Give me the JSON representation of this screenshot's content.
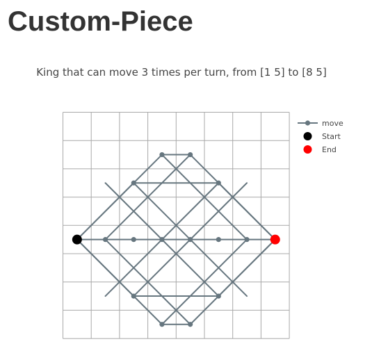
{
  "page": {
    "title": "Custom-Piece",
    "subtitle": "King that can move 3 times per turn, from [1 5] to [8 5]"
  },
  "colors": {
    "grid": "#a8a8a8",
    "move": "#66767f",
    "start": "#000000",
    "end": "#ff0000"
  },
  "legend": [
    {
      "label": "move",
      "marker": "line-dot",
      "color": "#66767f"
    },
    {
      "label": "Start",
      "marker": "dot",
      "color": "#000000"
    },
    {
      "label": "End",
      "marker": "dot",
      "color": "#ff0000"
    }
  ],
  "chart_data": {
    "type": "scatter",
    "board_files": 8,
    "board_ranks": 8,
    "start": [
      1,
      5
    ],
    "end": [
      8,
      5
    ],
    "moves": [
      [
        [
          1,
          5
        ],
        [
          4,
          8
        ]
      ],
      [
        [
          4,
          8
        ],
        [
          5,
          8
        ]
      ],
      [
        [
          5,
          8
        ],
        [
          8,
          5
        ]
      ],
      [
        [
          1,
          5
        ],
        [
          4,
          2
        ]
      ],
      [
        [
          4,
          2
        ],
        [
          5,
          2
        ]
      ],
      [
        [
          5,
          2
        ],
        [
          8,
          5
        ]
      ],
      [
        [
          1,
          5
        ],
        [
          3,
          7
        ]
      ],
      [
        [
          3,
          7
        ],
        [
          6,
          7
        ]
      ],
      [
        [
          6,
          7
        ],
        [
          8,
          5
        ]
      ],
      [
        [
          1,
          5
        ],
        [
          3,
          3
        ]
      ],
      [
        [
          3,
          3
        ],
        [
          6,
          3
        ]
      ],
      [
        [
          6,
          3
        ],
        [
          8,
          5
        ]
      ],
      [
        [
          1,
          5
        ],
        [
          8,
          5
        ]
      ],
      [
        [
          2,
          5
        ],
        [
          5,
          8
        ]
      ],
      [
        [
          4,
          8
        ],
        [
          7,
          5
        ]
      ],
      [
        [
          2,
          5
        ],
        [
          5,
          2
        ]
      ],
      [
        [
          4,
          2
        ],
        [
          7,
          5
        ]
      ],
      [
        [
          3,
          7
        ],
        [
          7,
          3
        ]
      ],
      [
        [
          6,
          7
        ],
        [
          2,
          3
        ]
      ],
      [
        [
          3,
          3
        ],
        [
          7,
          7
        ]
      ],
      [
        [
          6,
          3
        ],
        [
          2,
          7
        ]
      ]
    ],
    "points": [
      [
        2,
        5
      ],
      [
        3,
        5
      ],
      [
        4,
        5
      ],
      [
        5,
        5
      ],
      [
        6,
        5
      ],
      [
        7,
        5
      ],
      [
        3,
        7
      ],
      [
        6,
        7
      ],
      [
        3,
        3
      ],
      [
        6,
        3
      ],
      [
        4,
        8
      ],
      [
        5,
        8
      ],
      [
        4,
        2
      ],
      [
        5,
        2
      ]
    ]
  }
}
